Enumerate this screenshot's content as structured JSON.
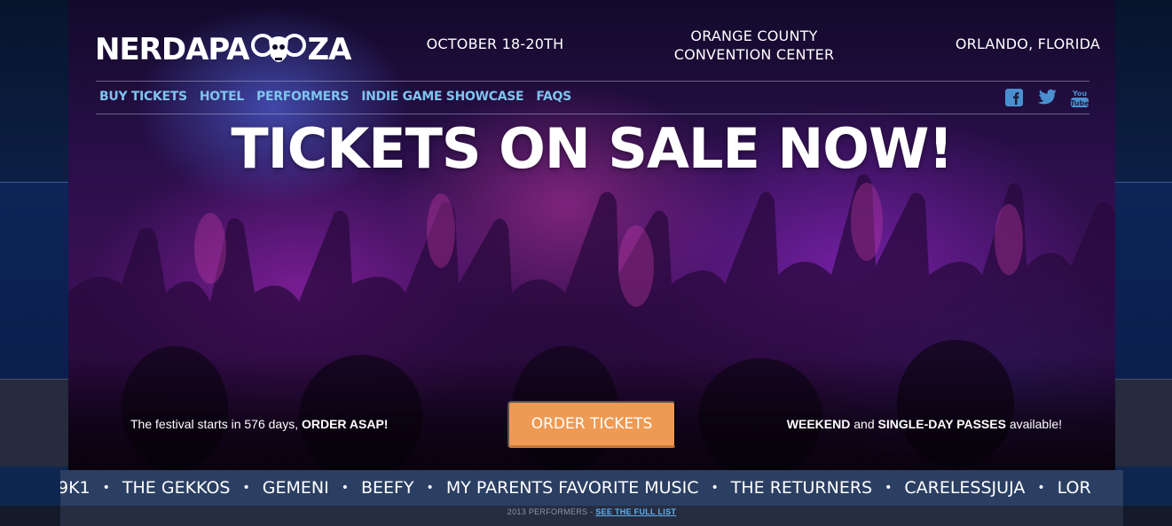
{
  "brand": {
    "logo_left": "NERDAPA",
    "logo_right": "ZA",
    "mark_icon": "ram-skull-icon"
  },
  "header": {
    "date": "OCTOBER 18-20TH",
    "venue_line1": "ORANGE COUNTY",
    "venue_line2": "CONVENTION CENTER",
    "city": "ORLANDO, FLORIDA"
  },
  "nav": {
    "items": [
      {
        "label": "BUY TICKETS"
      },
      {
        "label": "HOTEL"
      },
      {
        "label": "PERFORMERS"
      },
      {
        "label": "INDIE GAME SHOWCASE"
      },
      {
        "label": "FAQS"
      }
    ]
  },
  "social": {
    "icons": [
      "facebook-icon",
      "twitter-icon",
      "youtube-icon"
    ],
    "youtube_label": "You Tube"
  },
  "hero": {
    "headline": "TICKETS ON SALE NOW!"
  },
  "order": {
    "left_text": "The festival starts in 576 days, ",
    "left_bold": "ORDER ASAP!",
    "button_label": "ORDER TICKETS",
    "right_bold1": "WEEKEND",
    "right_and": " and ",
    "right_bold2": "SINGLE-DAY PASSES",
    "right_tail": " available!"
  },
  "ticker": {
    "items": [
      "9K1",
      "THE GEKKOS",
      "GEMENI",
      "BEEFY",
      "MY PARENTS FAVORITE MUSIC",
      "THE RETURNERS",
      "CARELESSJUJA",
      "LOR"
    ],
    "separator": "•"
  },
  "footer": {
    "text": "2013 PERFORMERS - ",
    "link": "SEE THE FULL LIST"
  },
  "colors": {
    "accent": "#ee9a55",
    "nav": "#7ec4ee",
    "ticker_bg": "#2b3f63"
  }
}
